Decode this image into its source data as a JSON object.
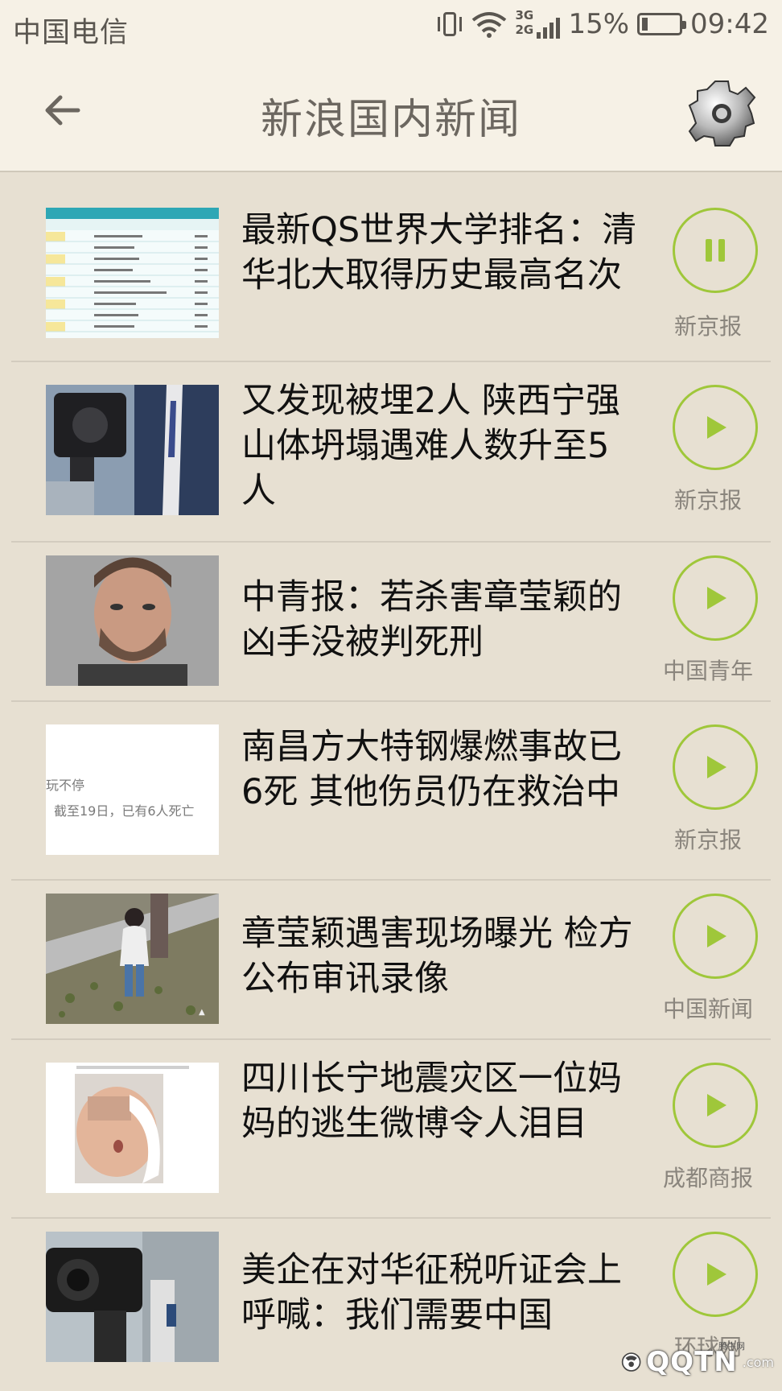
{
  "status_bar": {
    "carrier": "中国电信",
    "network_top": "3G",
    "network_bottom": "2G",
    "battery_percent": "15%",
    "battery_level": 0.15,
    "time": "09:42",
    "icons": [
      "vibrate-icon",
      "wifi-icon",
      "signal-icon",
      "battery-icon"
    ]
  },
  "header": {
    "title": "新浪国内新闻",
    "back_icon": "arrow-left-icon",
    "settings_icon": "gear-icon"
  },
  "colors": {
    "background": "#e7e0d2",
    "header_background": "#f6f1e6",
    "accent_green": "#9fc73a",
    "title_gray": "#6c6760"
  },
  "news": [
    {
      "headline": "最新QS世界大学排名：清华北大取得历史最高名次",
      "source": "新京报",
      "state": "playing",
      "button_icon": "pause-icon",
      "thumb": "ranking-table"
    },
    {
      "headline": "又发现被埋2人 陕西宁强山体坍塌遇难人数升至5人",
      "source": "新京报",
      "state": "stopped",
      "button_icon": "play-icon",
      "thumb": "camera-press"
    },
    {
      "headline": "中青报：若杀害章莹颖的凶手没被判死刑",
      "source": "中国青年",
      "state": "stopped",
      "button_icon": "play-icon",
      "thumb": "portrait"
    },
    {
      "headline": "南昌方大特钢爆燃事故已6死 其他伤员仍在救治中",
      "source": "新京报",
      "state": "stopped",
      "button_icon": "play-icon",
      "thumb": "text-snippet"
    },
    {
      "headline": "章莹颖遇害现场曝光 检方公布审讯录像",
      "source": "中国新闻",
      "state": "stopped",
      "button_icon": "play-icon",
      "thumb": "street-scene"
    },
    {
      "headline": "四川长宁地震灾区一位妈妈的逃生微博令人泪目",
      "source": "成都商报",
      "state": "stopped",
      "button_icon": "play-icon",
      "thumb": "baby-photo"
    },
    {
      "headline": "美企在对华征税听证会上呼喊：我们需要中国",
      "source": "环球网",
      "state": "stopped",
      "button_icon": "play-icon",
      "thumb": "camera-crew"
    }
  ],
  "thumb_text": {
    "snippet_line1": "玩不停",
    "snippet_line2": "，截至19日，已有6人死亡"
  },
  "watermark": {
    "site": "腾牛网",
    "text": "QQTN",
    "suffix": ".com"
  }
}
